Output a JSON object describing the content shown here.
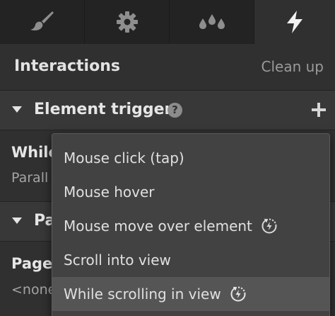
{
  "tabs": [
    {
      "icon": "brush-icon",
      "active": false
    },
    {
      "icon": "gear-icon",
      "active": false
    },
    {
      "icon": "drops-icon",
      "active": false
    },
    {
      "icon": "lightning-icon",
      "active": true
    }
  ],
  "header": {
    "title": "Interactions",
    "cleanup_label": "Clean up"
  },
  "element_trigger": {
    "title": "Element trigger",
    "help_icon": "?",
    "add_icon": "plus-icon"
  },
  "element_row": {
    "title": "While",
    "subtitle": "Parall"
  },
  "page_section": {
    "title": "Pa"
  },
  "page_row": {
    "title": "Page",
    "subtitle": "<none"
  },
  "dropdown": {
    "items": [
      {
        "label": "Mouse click (tap)",
        "has_icon": false,
        "selected": false
      },
      {
        "label": "Mouse hover",
        "has_icon": false,
        "selected": false
      },
      {
        "label": "Mouse move over element",
        "has_icon": true,
        "selected": false
      },
      {
        "label": "Scroll into view",
        "has_icon": false,
        "selected": false
      },
      {
        "label": "While scrolling in view",
        "has_icon": true,
        "selected": true
      }
    ]
  },
  "colors": {
    "background": "#303030",
    "tabbar": "#232323",
    "dropdown_bg": "#424242",
    "selected_bg": "#555555"
  }
}
